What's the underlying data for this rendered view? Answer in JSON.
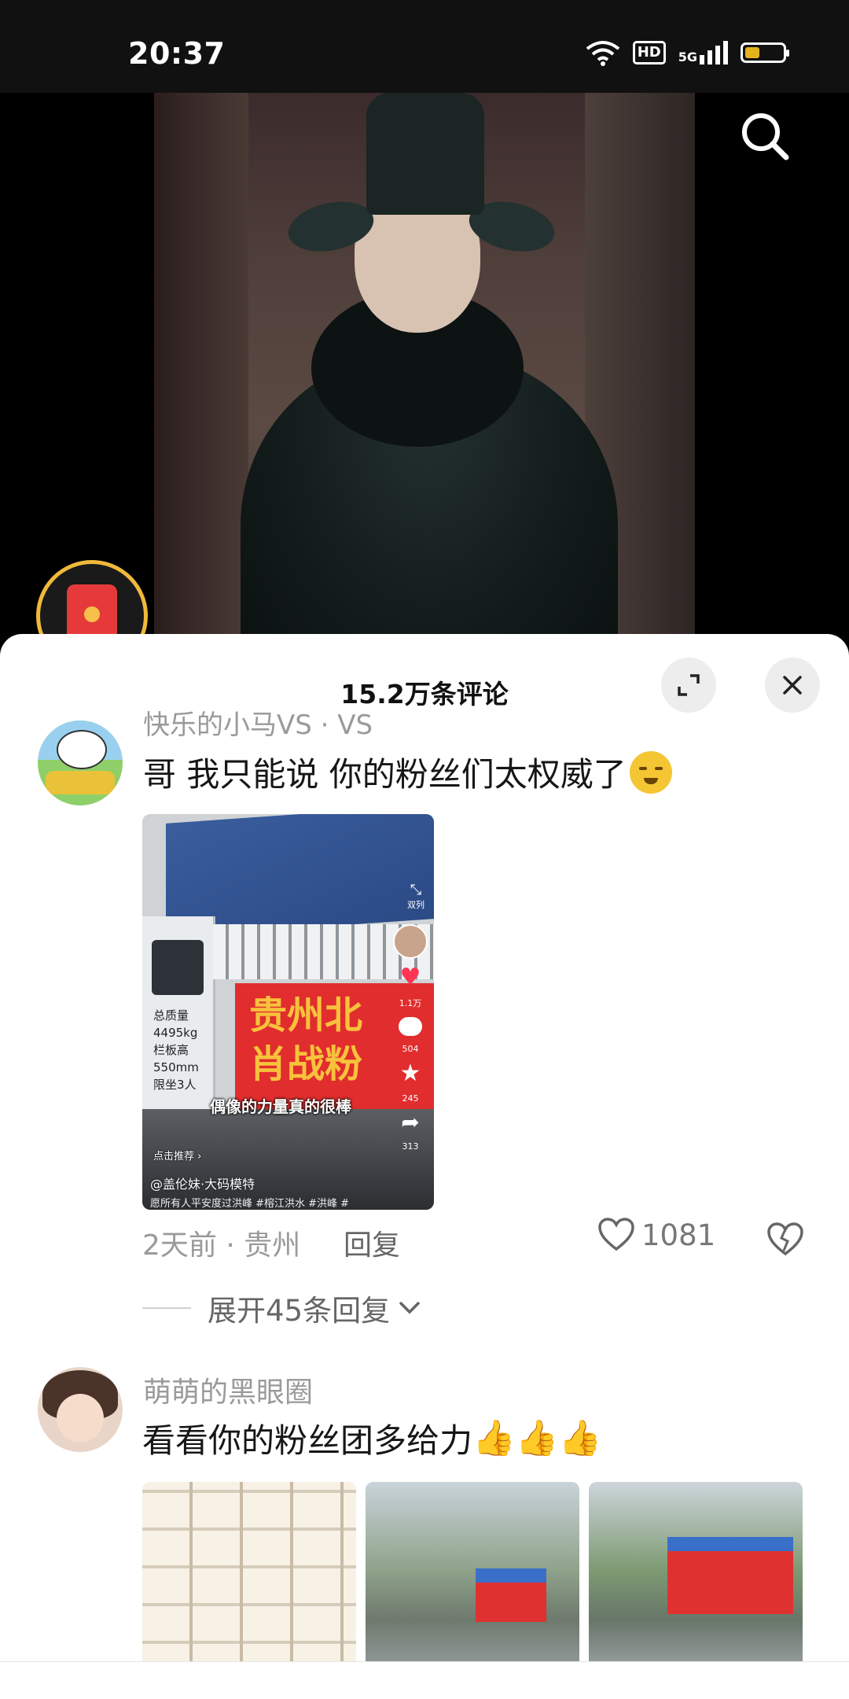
{
  "status_bar": {
    "time": "20:37",
    "hd": "HD",
    "network": "5G",
    "battery_level": 0.34,
    "icons": [
      "wifi-icon",
      "hd-icon",
      "signal-5g-icon",
      "battery-icon"
    ]
  },
  "video": {
    "search_icon": "search-icon",
    "red_packet_icon": "red-packet-icon"
  },
  "comments_sheet": {
    "title": "15.2万条评论",
    "expand_icon": "expand-icon",
    "close_icon": "close-icon",
    "comments": [
      {
        "author": "快乐的小马VS · VS",
        "text": "哥 我只能说 你的粉丝们太权威了",
        "emoji": "crying-face-emoji",
        "media": {
          "caption": "偶像的力量真的很棒",
          "banner_text": "贵州北\n肖战粉",
          "author": "@盖伦妹·大码模特",
          "recommend": "点击推荐 ›",
          "description": "愿所有人平安度过洪峰 #榕江洪水 #洪峰 #",
          "double_col": "双列",
          "like_count": "1.1万",
          "comment_count": "504",
          "star_count": "245",
          "share_count": "313",
          "cab_text": "总质量\n4495kg\n栏板高\n550mm\n限坐3人"
        },
        "time_location": "2天前 · 贵州",
        "reply_label": "回复",
        "like_count": "1081",
        "expand_replies": "展开45条回复"
      },
      {
        "author": "萌萌的黑眼圈",
        "text": "看看你的粉丝团多给力",
        "emoji": "thumbs-up-emoji",
        "emoji_count": 3
      }
    ]
  }
}
